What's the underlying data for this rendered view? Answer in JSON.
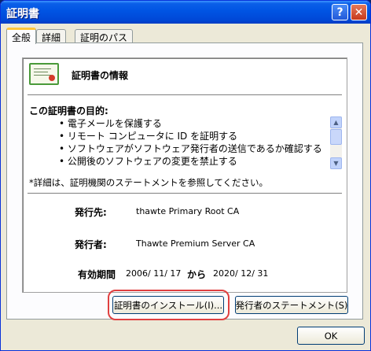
{
  "window": {
    "title": "証明書"
  },
  "titlebar": {
    "help_glyph": "?",
    "close_glyph": "✕"
  },
  "tabs": [
    {
      "label": "全般"
    },
    {
      "label": "詳細"
    },
    {
      "label": "証明のパス"
    }
  ],
  "info": {
    "title": "証明書の情報",
    "purpose_heading": "この証明書の目的:",
    "purposes": [
      "• 電子メールを保護する",
      "• リモート コンピュータに ID を証明する",
      "• ソフトウェアがソフトウェア発行者の送信であるか確認する",
      "• 公開後のソフトウェアの変更を禁止する"
    ],
    "note": "*詳細は、証明機関のステートメントを参照してください。",
    "issued_to_label": "発行先:",
    "issued_to_value": "thawte Primary Root CA",
    "issued_by_label": "発行者:",
    "issued_by_value": "Thawte Premium Server CA",
    "validity_label": "有効期間",
    "valid_from": "2006/ 11/ 17",
    "from_word": "から",
    "valid_to": "2020/ 12/ 31"
  },
  "buttons": {
    "install": "証明書のインストール(I)...",
    "issuer_statement": "発行者のステートメント(S)",
    "ok": "OK"
  },
  "colors": {
    "titlebar": "#0054e3",
    "dialog_bg": "#ece9d8",
    "highlight": "#e04040",
    "active_tab_accent": "#ffc73c"
  }
}
